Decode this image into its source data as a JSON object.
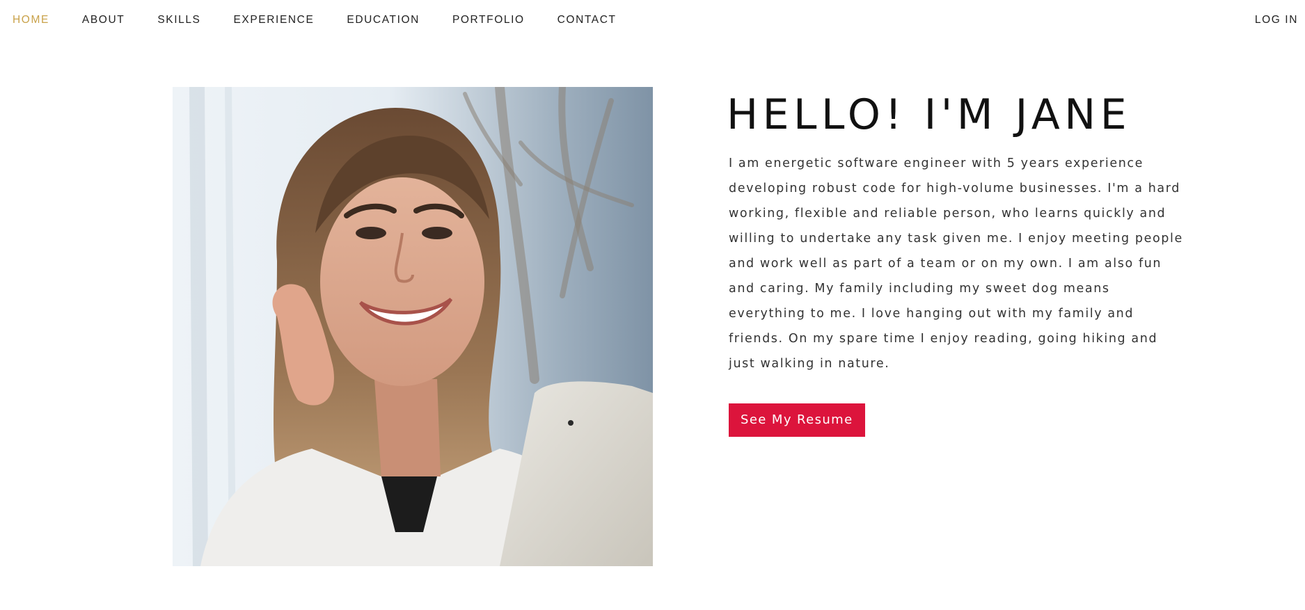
{
  "nav": {
    "items": [
      {
        "label": "HOME",
        "active": true
      },
      {
        "label": "ABOUT",
        "active": false
      },
      {
        "label": "SKILLS",
        "active": false
      },
      {
        "label": "EXPERIENCE",
        "active": false
      },
      {
        "label": "EDUCATION",
        "active": false
      },
      {
        "label": "PORTFOLIO",
        "active": false
      },
      {
        "label": "CONTACT",
        "active": false
      }
    ],
    "login_label": "LOG IN",
    "active_color": "#c9a24a"
  },
  "hero": {
    "title": "HELLO! I'M JANE",
    "bio": "I am energetic software engineer with 5 years experience developing robust code for high-volume businesses. I'm a hard working, flexible and reliable person, who learns quickly and willing to undertake any task given me. I enjoy meeting people and work well as part of a team or on my own. I am also fun and caring. My family including my sweet dog means everything to me. I love hanging out with my family and friends. On my spare time I enjoy reading, going hiking and just walking in nature.",
    "resume_button_label": "See My Resume",
    "button_color": "#dc143c"
  }
}
